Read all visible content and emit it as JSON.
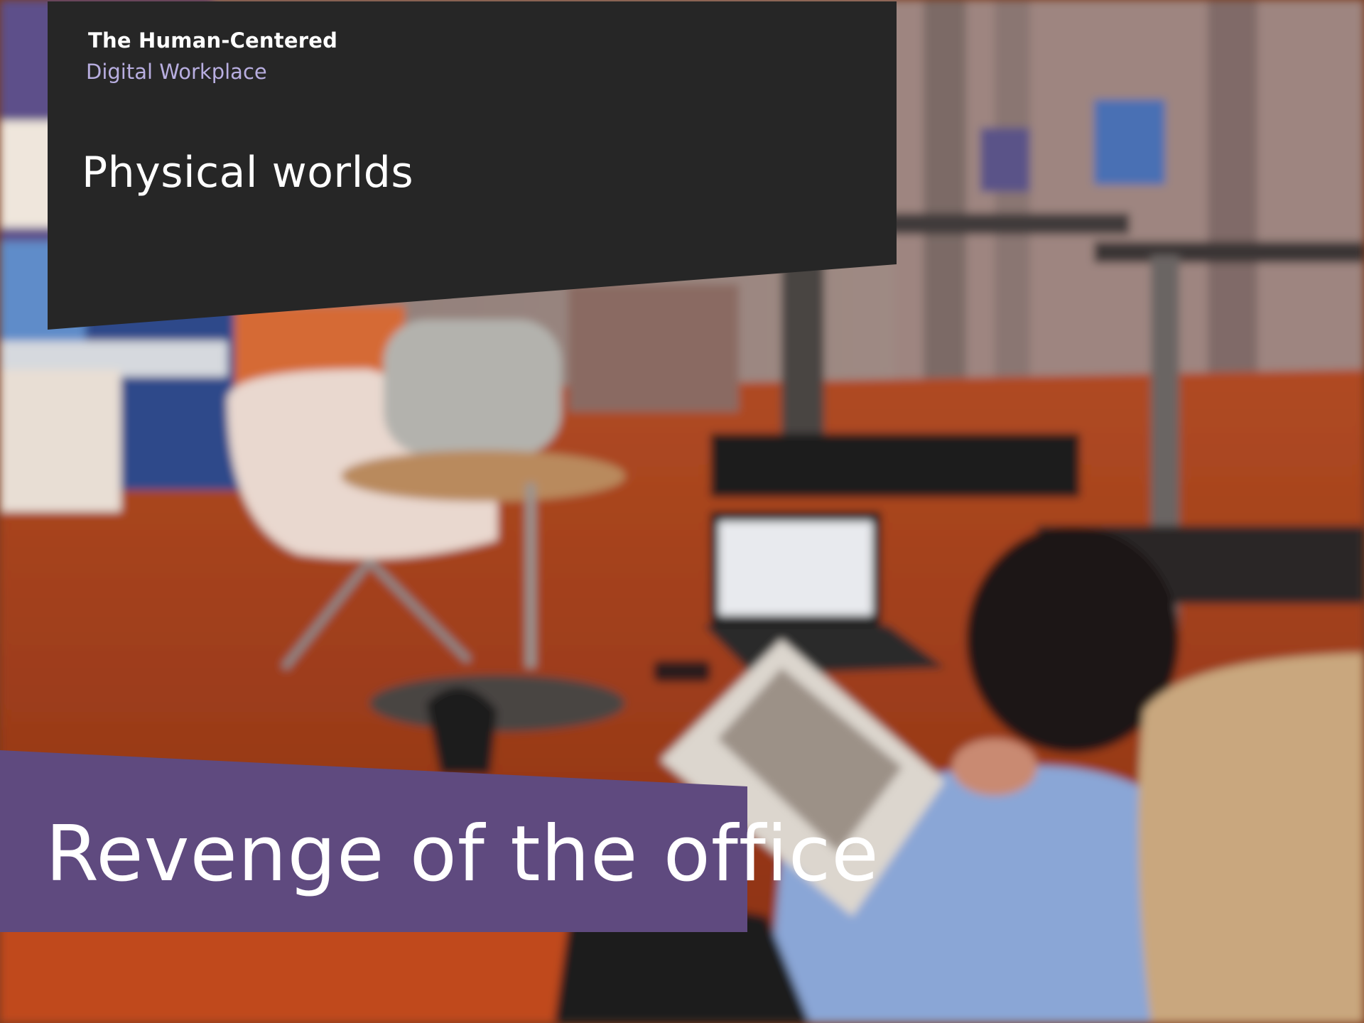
{
  "header": {
    "brand_title": "The Human-Centered",
    "brand_subtitle": "Digital Workplace",
    "section_title": "Physical worlds"
  },
  "banner": {
    "text": "Revenge of the office"
  },
  "colors": {
    "panel_dark": "#262626",
    "banner_purple": "#5f4a7f",
    "subtitle_lavender": "#b8aee0",
    "floor_orange": "#b9471f"
  }
}
